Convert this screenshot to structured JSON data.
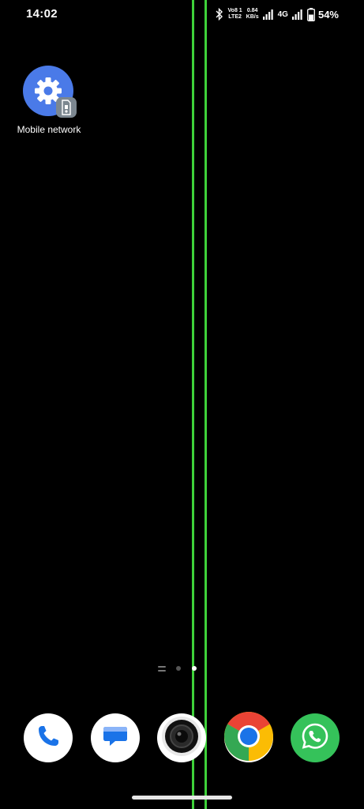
{
  "status_bar": {
    "time": "14:02",
    "volte_top": "Vo8 1",
    "volte_bottom": "LTE2",
    "speed_value": "0.84",
    "speed_unit": "KB/s",
    "network_type": "4G",
    "battery_percent": "54%",
    "battery_level": 0.54,
    "icons": [
      "bluetooth-icon",
      "volte-icon",
      "signal-icon",
      "signal-icon",
      "battery-icon"
    ]
  },
  "home_apps": [
    {
      "label": "Mobile network",
      "icon": "settings-gear-icon",
      "color": "#4a7ae8"
    }
  ],
  "page_indicator": {
    "pages": 2,
    "active_page": 2
  },
  "dock": [
    {
      "name": "phone",
      "icon": "phone-icon"
    },
    {
      "name": "messages",
      "icon": "messages-icon"
    },
    {
      "name": "camera",
      "icon": "camera-icon"
    },
    {
      "name": "chrome",
      "icon": "chrome-icon"
    },
    {
      "name": "whatsapp",
      "icon": "whatsapp-icon"
    }
  ],
  "colors": {
    "background": "#000000",
    "overlay_line": "#3ed13a",
    "settings_blue": "#4a7ae8",
    "whatsapp_green": "#35c25a"
  }
}
